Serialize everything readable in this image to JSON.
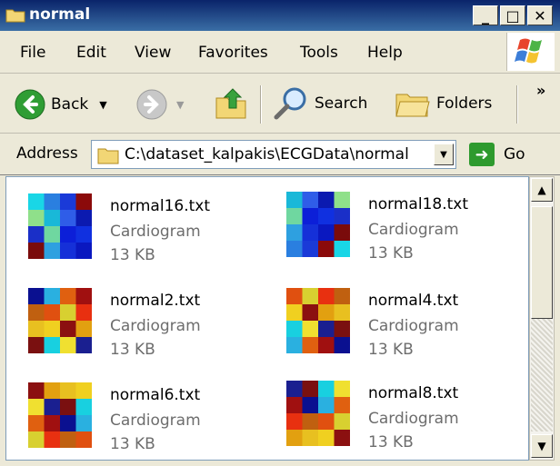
{
  "window": {
    "title": "normal"
  },
  "menu": [
    "File",
    "Edit",
    "View",
    "Favorites",
    "Tools",
    "Help"
  ],
  "toolbar": {
    "back": "Back",
    "search": "Search",
    "folders": "Folders",
    "overflow": "»"
  },
  "address": {
    "label": "Address",
    "path": "C:\\dataset_kalpakis\\ECGData\\normal",
    "go": "Go"
  },
  "files": [
    {
      "name": "normal16.txt",
      "type": "Cardiogram",
      "size": "13 KB",
      "palette": "cool"
    },
    {
      "name": "normal18.txt",
      "type": "Cardiogram",
      "size": "13 KB",
      "palette": "cool"
    },
    {
      "name": "normal2.txt",
      "type": "Cardiogram",
      "size": "13 KB",
      "palette": "warm"
    },
    {
      "name": "normal4.txt",
      "type": "Cardiogram",
      "size": "13 KB",
      "palette": "warm"
    },
    {
      "name": "normal6.txt",
      "type": "Cardiogram",
      "size": "13 KB",
      "palette": "warm"
    },
    {
      "name": "normal8.txt",
      "type": "Cardiogram",
      "size": "13 KB",
      "palette": "warm"
    }
  ],
  "colors": {
    "title_bar": "#0a246a",
    "accent": "#3a6ea5"
  }
}
